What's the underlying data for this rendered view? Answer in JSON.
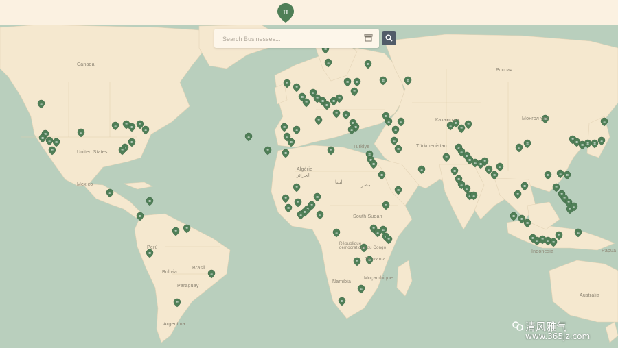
{
  "header": {
    "logo_icon": "pi-map-pin-icon"
  },
  "search": {
    "placeholder": "Search Businesses...",
    "filter_icon": "storefront-icon",
    "button_icon": "magnifier-icon"
  },
  "map": {
    "labels": {
      "canada": "Canada",
      "united_states": "United States",
      "mexico": "Mexico",
      "brazil": "Brasil",
      "bolivia": "Bolivia",
      "paraguay": "Paraguay",
      "argentina": "Argentina",
      "peru": "Perú",
      "algeria": "Algérie",
      "algeria_ar": "الجزائر",
      "libya": "ليبيا",
      "egypt": "مصر",
      "south_sudan": "South Sudan",
      "drc": "République démocratique du Congo",
      "mozambique": "Moçambique",
      "tanzania": "Tanzania",
      "namibia": "Namibia",
      "turkey": "Türkiye",
      "kazakhstan": "Казахстан",
      "turkmenistan": "Türkmenistan",
      "mongolia": "Монгол улс",
      "russia": "Россия",
      "australia": "Australia",
      "papua": "Papua",
      "indonesia": "Indonesia"
    },
    "pin_icon": "pi-map-pin-icon",
    "colors": {
      "land": "#f5e8cf",
      "water": "#b9cfbd",
      "pin": "#4f7f57",
      "header": "#fbf1e1",
      "search_button": "#515c69"
    }
  },
  "watermark": {
    "text": "清风雅气",
    "url": "www.365jz.com"
  }
}
